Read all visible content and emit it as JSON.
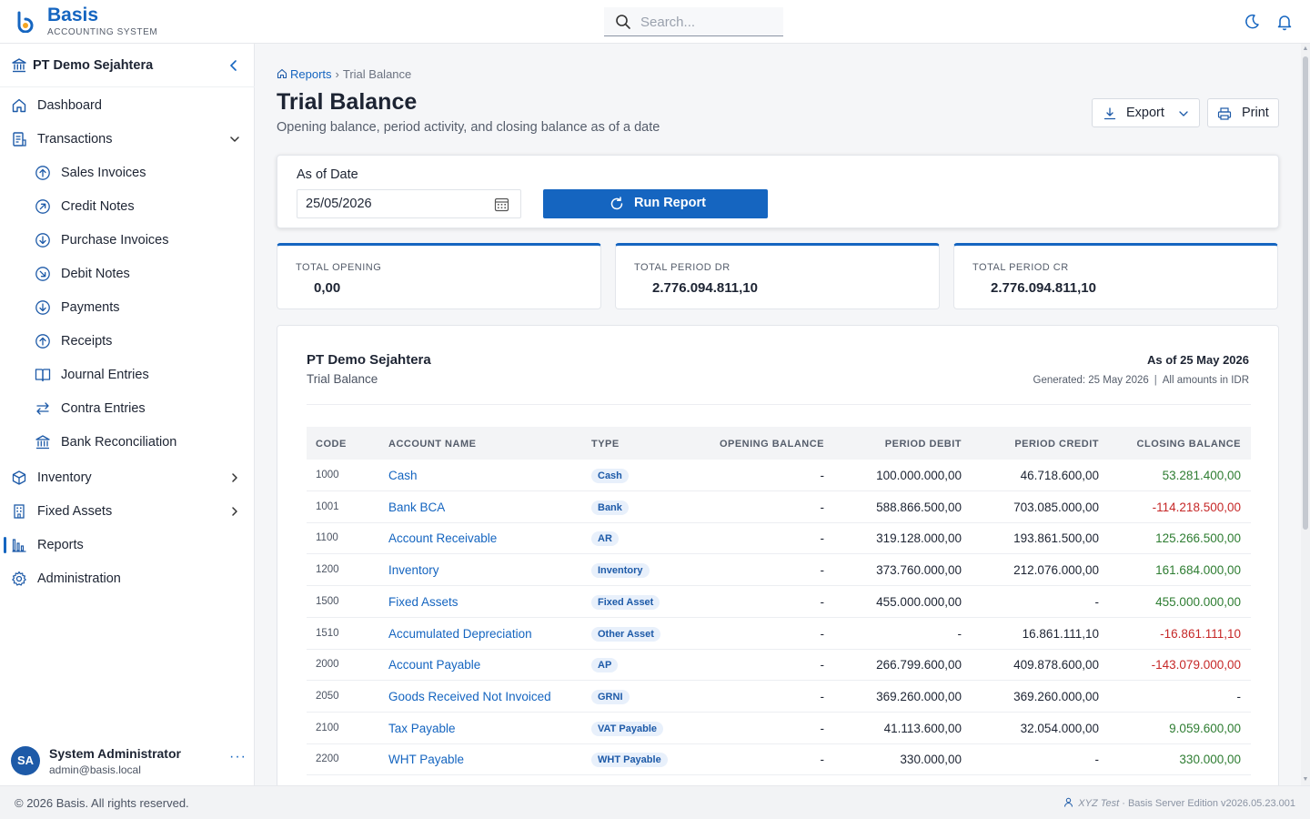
{
  "app": {
    "brand": "Basis",
    "brand_subtitle": "ACCOUNTING SYSTEM",
    "accent_color": "#1565c0"
  },
  "search": {
    "placeholder": "Search..."
  },
  "sidebar": {
    "company": "PT Demo Sejahtera",
    "items": [
      {
        "label": "Dashboard",
        "icon": "home-icon"
      },
      {
        "label": "Transactions",
        "icon": "document-icon",
        "expanded": true
      },
      {
        "label": "Sales Invoices",
        "icon": "arrow-up-circle-icon"
      },
      {
        "label": "Credit Notes",
        "icon": "arrow-up-right-circle-icon"
      },
      {
        "label": "Purchase Invoices",
        "icon": "arrow-down-circle-icon"
      },
      {
        "label": "Debit Notes",
        "icon": "arrow-down-right-circle-icon"
      },
      {
        "label": "Payments",
        "icon": "arrow-down-circle-icon"
      },
      {
        "label": "Receipts",
        "icon": "arrow-up-circle-icon"
      },
      {
        "label": "Journal Entries",
        "icon": "book-icon"
      },
      {
        "label": "Contra Entries",
        "icon": "swap-icon"
      },
      {
        "label": "Bank Reconciliation",
        "icon": "bank-icon"
      },
      {
        "label": "Inventory",
        "icon": "box-icon"
      },
      {
        "label": "Fixed Assets",
        "icon": "building-icon"
      },
      {
        "label": "Reports",
        "icon": "bar-chart-icon",
        "active": true
      },
      {
        "label": "Administration",
        "icon": "gear-icon"
      }
    ],
    "user": {
      "initials": "SA",
      "name": "System Administrator",
      "email": "admin@basis.local",
      "menu": "···"
    }
  },
  "breadcrumb": {
    "home": "Reports",
    "sep": "›",
    "current": "Trial Balance"
  },
  "page": {
    "title": "Trial Balance",
    "subtitle": "Opening balance, period activity, and closing balance as of a date",
    "export_label": "Export",
    "print_label": "Print"
  },
  "filter": {
    "as_of_label": "As of Date",
    "as_of_value": "25/05/2026",
    "run_label": "Run Report"
  },
  "stats": [
    {
      "label": "TOTAL OPENING",
      "value": "0,00"
    },
    {
      "label": "TOTAL PERIOD DR",
      "value": "2.776.094.811,10"
    },
    {
      "label": "TOTAL PERIOD CR",
      "value": "2.776.094.811,10"
    }
  ],
  "report": {
    "company": "PT Demo Sejahtera",
    "title": "Trial Balance",
    "as_of": "As of 25 May 2026",
    "generated": "Generated: 25 May 2026",
    "pipe": "|",
    "currency_note": "All amounts in IDR",
    "columns": [
      "CODE",
      "ACCOUNT NAME",
      "TYPE",
      "OPENING BALANCE",
      "PERIOD DEBIT",
      "PERIOD CREDIT",
      "CLOSING BALANCE"
    ],
    "rows": [
      {
        "code": "1000",
        "name": "Cash",
        "type": "Cash",
        "opening": "-",
        "debit": "100.000.000,00",
        "credit": "46.718.600,00",
        "closing": "53.281.400,00",
        "sign": "pos"
      },
      {
        "code": "1001",
        "name": "Bank BCA",
        "type": "Bank",
        "opening": "-",
        "debit": "588.866.500,00",
        "credit": "703.085.000,00",
        "closing": "-114.218.500,00",
        "sign": "neg"
      },
      {
        "code": "1100",
        "name": "Account Receivable",
        "type": "AR",
        "opening": "-",
        "debit": "319.128.000,00",
        "credit": "193.861.500,00",
        "closing": "125.266.500,00",
        "sign": "pos"
      },
      {
        "code": "1200",
        "name": "Inventory",
        "type": "Inventory",
        "opening": "-",
        "debit": "373.760.000,00",
        "credit": "212.076.000,00",
        "closing": "161.684.000,00",
        "sign": "pos"
      },
      {
        "code": "1500",
        "name": "Fixed Assets",
        "type": "Fixed Asset",
        "opening": "-",
        "debit": "455.000.000,00",
        "credit": "-",
        "closing": "455.000.000,00",
        "sign": "pos"
      },
      {
        "code": "1510",
        "name": "Accumulated Depreciation",
        "type": "Other Asset",
        "opening": "-",
        "debit": "-",
        "credit": "16.861.111,10",
        "closing": "-16.861.111,10",
        "sign": "neg"
      },
      {
        "code": "2000",
        "name": "Account Payable",
        "type": "AP",
        "opening": "-",
        "debit": "266.799.600,00",
        "credit": "409.878.600,00",
        "closing": "-143.079.000,00",
        "sign": "neg"
      },
      {
        "code": "2050",
        "name": "Goods Received Not Invoiced",
        "type": "GRNI",
        "opening": "-",
        "debit": "369.260.000,00",
        "credit": "369.260.000,00",
        "closing": "-",
        "sign": "zero"
      },
      {
        "code": "2100",
        "name": "Tax Payable",
        "type": "VAT Payable",
        "opening": "-",
        "debit": "41.113.600,00",
        "credit": "32.054.000,00",
        "closing": "9.059.600,00",
        "sign": "pos"
      },
      {
        "code": "2200",
        "name": "WHT Payable",
        "type": "WHT Payable",
        "opening": "-",
        "debit": "330.000,00",
        "credit": "-",
        "closing": "330.000,00",
        "sign": "pos"
      }
    ]
  },
  "footer": {
    "copyright": "© 2026 Basis. All rights reserved.",
    "tenant": "XYZ Test",
    "dot": "·",
    "edition": "Basis Server Edition v2026.05.23.001"
  }
}
